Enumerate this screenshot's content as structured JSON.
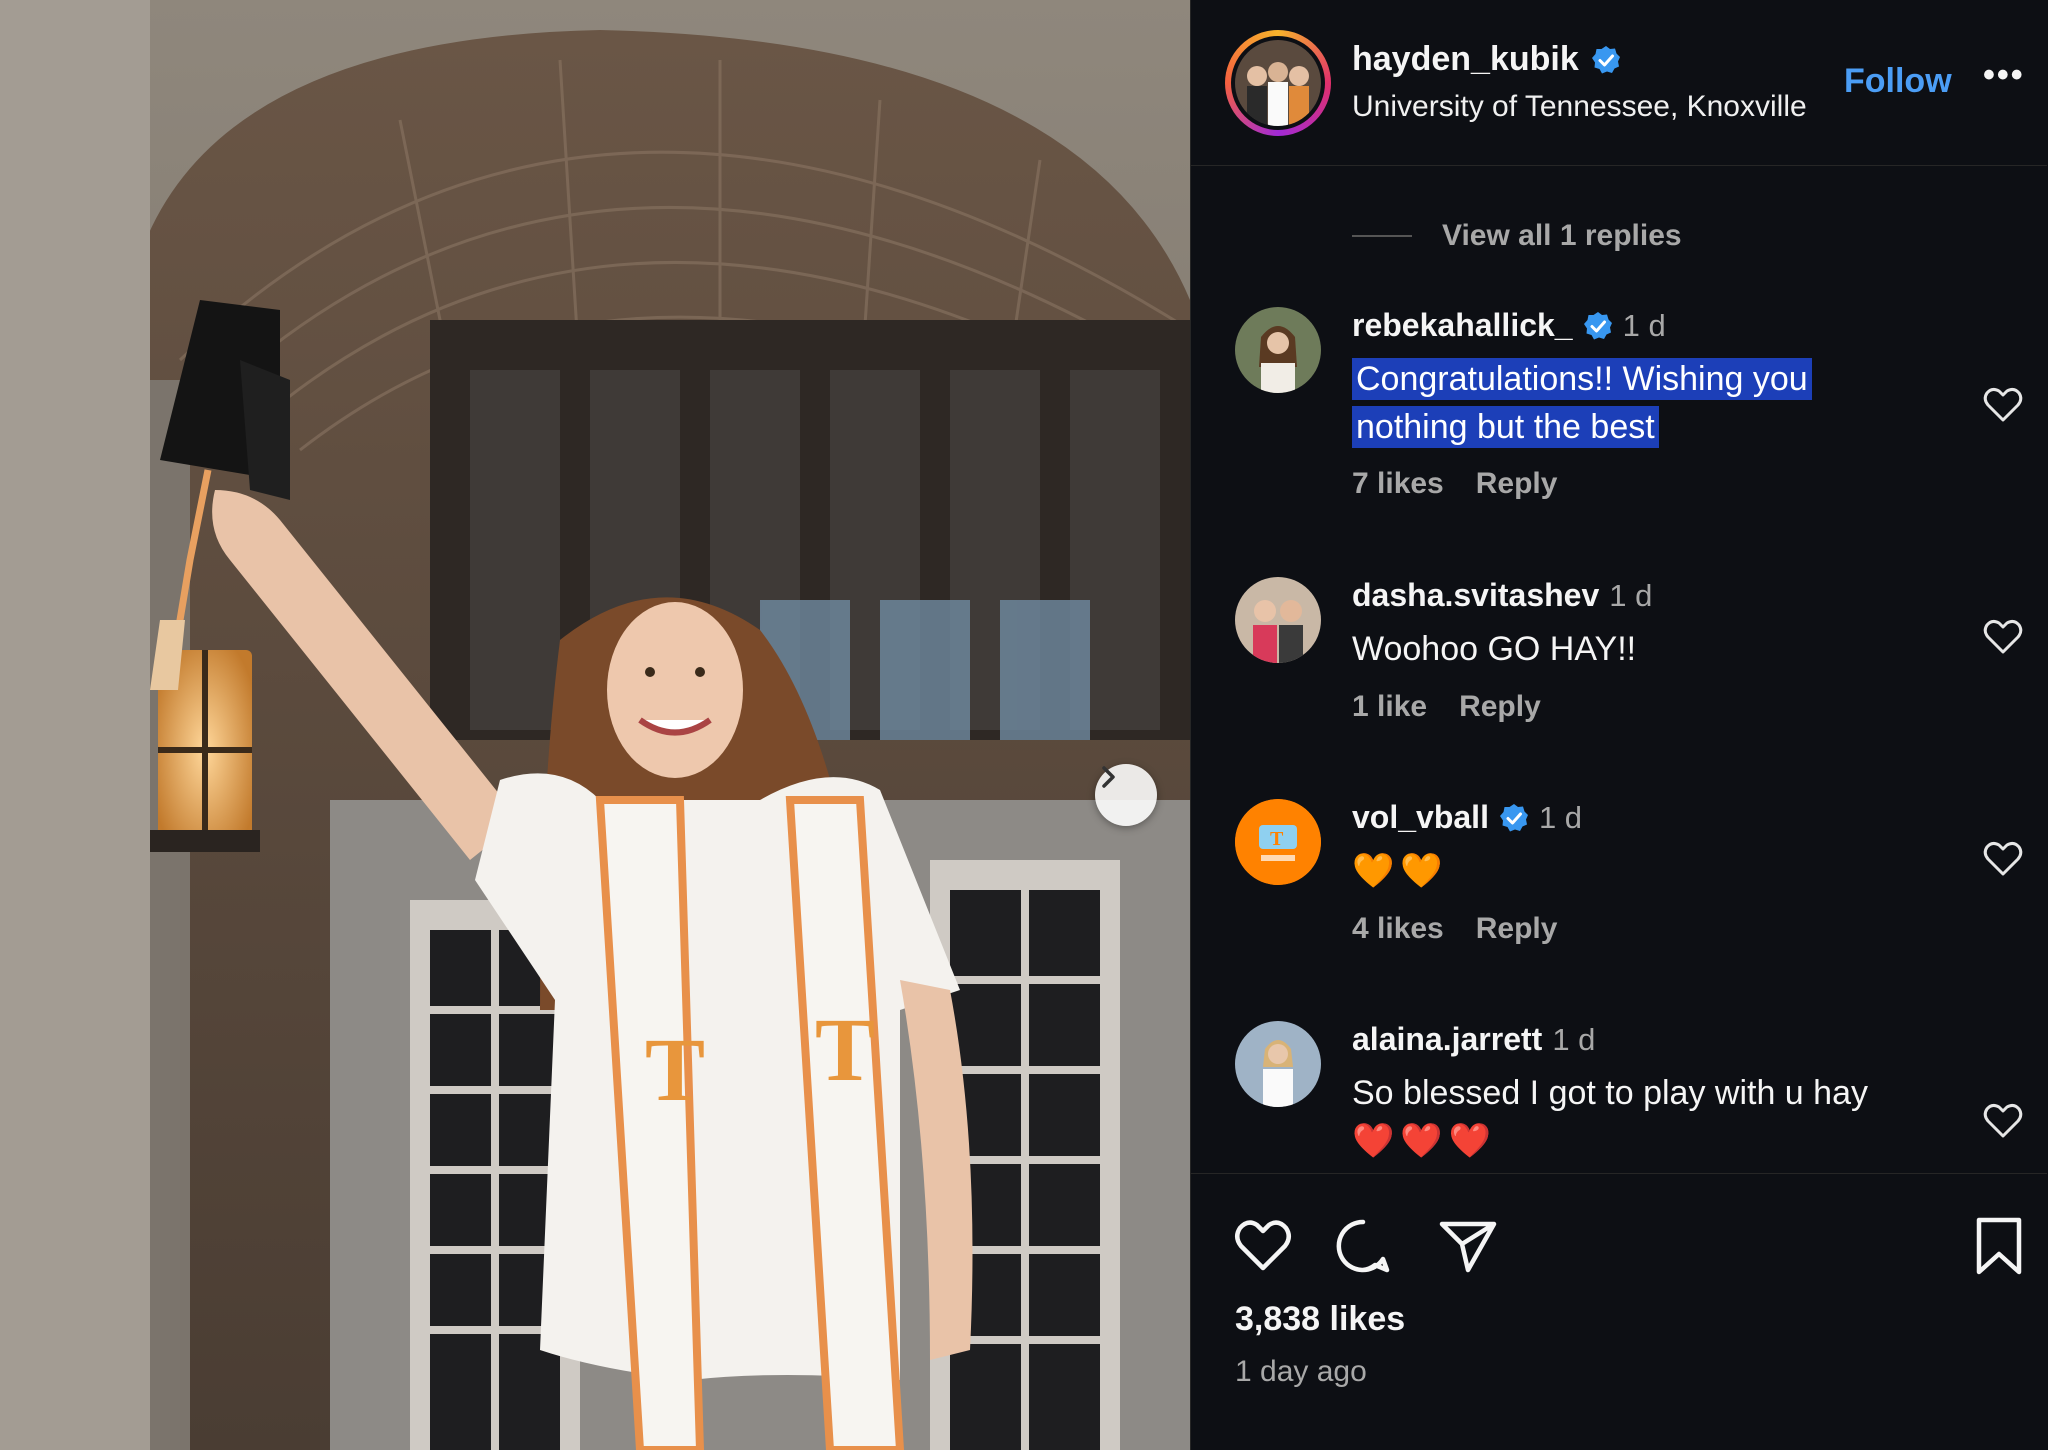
{
  "post": {
    "username": "hayden_kubik",
    "location": "University of Tennessee, Knoxville",
    "follow_label": "Follow",
    "more_label": "•••",
    "likes": "3,838 likes",
    "date": "1 day ago"
  },
  "comments": {
    "view_replies": "View all 1 replies",
    "items": [
      {
        "user": "rebekahallick_",
        "verified": true,
        "time": "1 d",
        "text_line1": "Congratulations!! Wishing you",
        "text_line2": "nothing but the best",
        "likes": "7 likes",
        "reply": "Reply"
      },
      {
        "user": "dasha.svitashev",
        "verified": false,
        "time": "1 d",
        "text": "Woohoo GO HAY!!",
        "likes": "1 like",
        "reply": "Reply"
      },
      {
        "user": "vol_vball",
        "verified": true,
        "time": "1 d",
        "text": "🧡🧡",
        "likes": "4 likes",
        "reply": "Reply"
      },
      {
        "user": "alaina.jarrett",
        "verified": false,
        "time": "1 d",
        "text": "So blessed I got to play with u hay",
        "text_line2": "❤️❤️❤️"
      }
    ]
  },
  "icons": [
    "verified-icon",
    "heart-icon",
    "comment-icon",
    "share-icon",
    "bookmark-icon",
    "chevron-right-icon",
    "more-icon"
  ],
  "colors": {
    "accent": "#4b9df5",
    "highlight": "#1c3fb8",
    "orange": "#ff8200",
    "panel_bg": "#0d0f14"
  }
}
